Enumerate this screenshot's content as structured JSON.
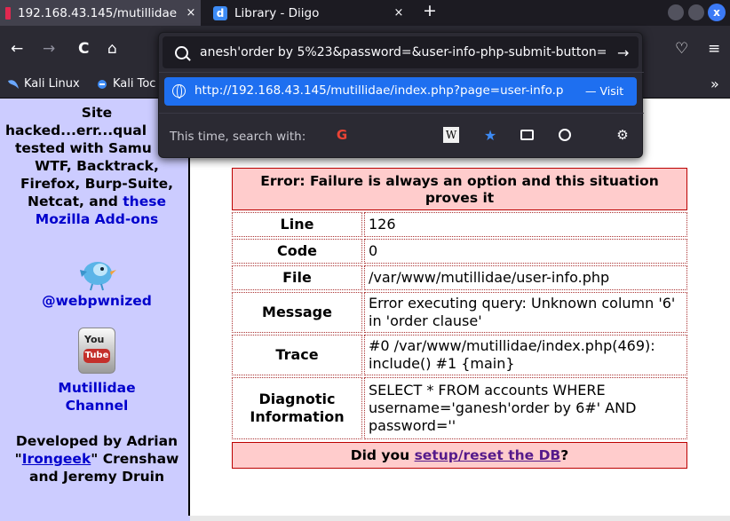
{
  "tabs": [
    {
      "title": "192.168.43.145/mutillidae",
      "close": "×"
    },
    {
      "title": "Library - Diigo",
      "close": "×"
    }
  ],
  "newtab_label": "+",
  "window_close_label": "x",
  "nav": {
    "back": "←",
    "forward": "→",
    "reload": "C",
    "home": "⌂",
    "pocket": "♡",
    "menu": "≡"
  },
  "bookmarks": [
    {
      "label": "Kali Linux"
    },
    {
      "label": "Kali Toc"
    }
  ],
  "bookmarks_more": "»",
  "urlbar": {
    "value": "anesh'order by 5%23&password=&user-info-php-submit-button=",
    "go": "→"
  },
  "suggestion": {
    "url": "http://192.168.43.145/mutillidae/index.php?page=user-info.p",
    "visit": "— Visit"
  },
  "search_with": "This time, search with:",
  "engines": {
    "google": "G",
    "wikipedia": "W",
    "bookmarks": "★",
    "gear": "⚙"
  },
  "sidebar": {
    "text1": "Site",
    "text2": "hacked...err...qual",
    "text3": "tested with Samu",
    "text4": "WTF, Backtrack,",
    "text5": "Firefox, Burp-Suite,",
    "text6": "Netcat, and",
    "these_link": "these",
    "addons_link": "Mozilla Add-ons",
    "twitter_link": "@webpwnized",
    "youtube_you": "You",
    "youtube_tube": "Tube",
    "channel_line1": "Mutillidae",
    "channel_line2": "Channel",
    "dev_line1": "Developed by Adrian",
    "dev_quote_open": "\"",
    "irongeek_link": "Irongeek",
    "dev_quote_rest": "\" Crenshaw",
    "dev_line3": "and Jeremy Druin"
  },
  "error": {
    "header": "Error: Failure is always an option and this situation proves it",
    "rows": [
      {
        "key": "Line",
        "value": "126"
      },
      {
        "key": "Code",
        "value": "0"
      },
      {
        "key": "File",
        "value": "/var/www/mutillidae/user-info.php"
      },
      {
        "key": "Message",
        "value": "Error executing query: Unknown column '6' in 'order clause'"
      },
      {
        "key": "Trace",
        "value": "#0 /var/www/mutillidae/index.php(469): include() #1 {main}"
      },
      {
        "key": "Diagnotic Information",
        "value": "SELECT * FROM accounts WHERE username='ganesh'order by 6#' AND password=''"
      }
    ],
    "footer_prefix": "Did you ",
    "footer_link": "setup/reset the DB",
    "footer_suffix": "?"
  }
}
